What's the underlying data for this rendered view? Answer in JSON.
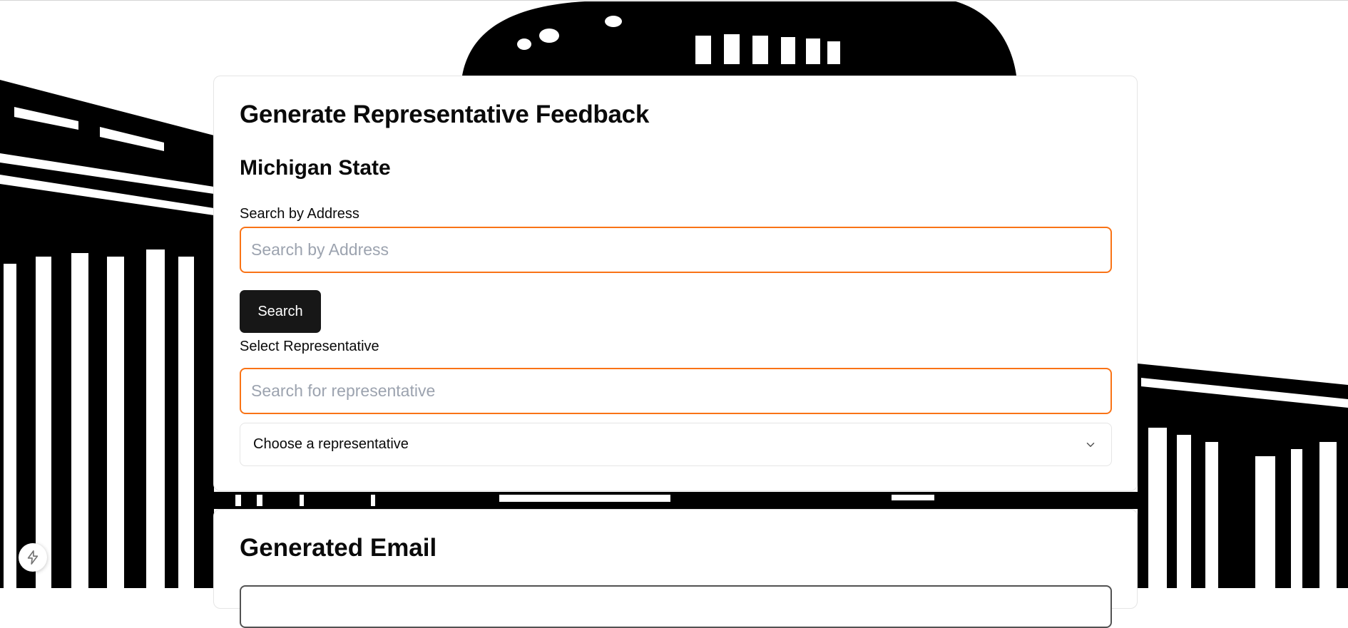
{
  "main_card": {
    "title": "Generate Representative Feedback",
    "state_heading": "Michigan State",
    "address_label": "Search by Address",
    "address_placeholder": "Search by Address",
    "search_button": "Search",
    "representative_label": "Select Representative",
    "representative_search_placeholder": "Search for representative",
    "representative_select_value": "Choose a representative"
  },
  "email_card": {
    "title": "Generated Email"
  },
  "icons": {
    "select_chevron": "chevron-down-icon",
    "floating_button": "lightning-bolt-icon"
  },
  "colors": {
    "accent": "#f97316",
    "button": "#171717"
  }
}
